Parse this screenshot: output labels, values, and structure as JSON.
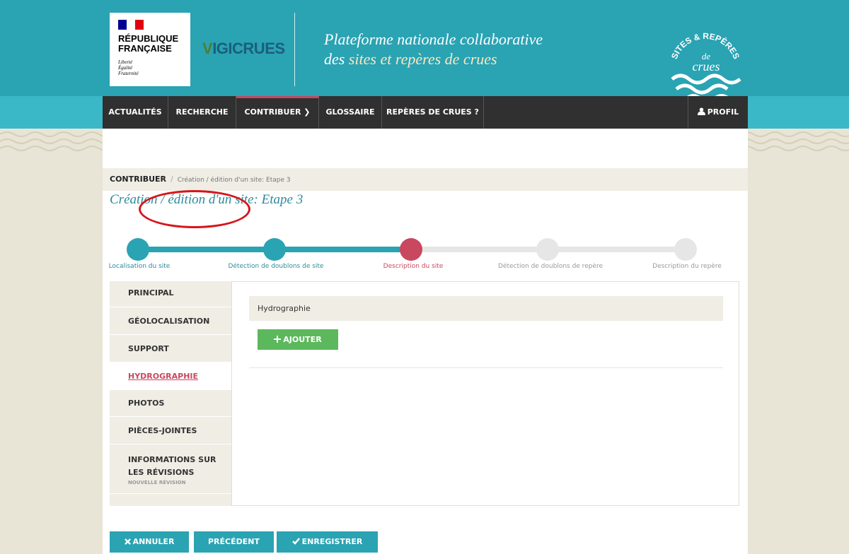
{
  "header": {
    "rf_title_line1": "RÉPUBLIQUE",
    "rf_title_line2": "FRANÇAISE",
    "rf_motto_1": "Liberté",
    "rf_motto_2": "Égalité",
    "rf_motto_3": "Fraternité",
    "vigicrues_v": "V",
    "vigicrues_rest": "IGICRUES",
    "tagline_line1": "Plateforme nationale collaborative",
    "tagline_line2_prefix": "des ",
    "tagline_line2_highlight": "sites et repères de crues",
    "sr_logo_top": "SITES & REPÈRES",
    "sr_logo_de": "de",
    "sr_logo_crues": "crues"
  },
  "nav": {
    "items": [
      {
        "label": "ACTUALITÉS"
      },
      {
        "label": "RECHERCHE"
      },
      {
        "label": "CONTRIBUER ❯"
      },
      {
        "label": "GLOSSAIRE"
      },
      {
        "label": "REPÈRES DE CRUES ?"
      }
    ],
    "profile": "PROFIL",
    "profile_icon": "user-icon",
    "active_index": 2
  },
  "breadcrumb": {
    "root": "CONTRIBUER",
    "separator": "/",
    "current": "Création / édition d'un site: Etape 3"
  },
  "page_title": "Création / édition d'un site: Etape 3",
  "stepper": {
    "steps": [
      {
        "label": "Localisation du site",
        "state": "done"
      },
      {
        "label": "Détection de doublons de site",
        "state": "done"
      },
      {
        "label": "Description du site",
        "state": "current"
      },
      {
        "label": "Détection de doublons de repère",
        "state": "todo"
      },
      {
        "label": "Description du repère",
        "state": "todo"
      }
    ]
  },
  "sidebar": {
    "items": [
      {
        "label": "PRINCIPAL"
      },
      {
        "label": "GÉOLOCALISATION"
      },
      {
        "label": "SUPPORT"
      },
      {
        "label": "HYDROGRAPHIE"
      },
      {
        "label": "PHOTOS"
      },
      {
        "label": "PIÈCES-JOINTES"
      },
      {
        "label": "INFORMATIONS SUR LES RÉVISIONS",
        "sub": "NOUVELLE RÉVISION"
      }
    ],
    "active_index": 3
  },
  "content": {
    "section_title": "Hydrographie",
    "add_button": "AJOUTER",
    "add_icon": "plus-icon"
  },
  "footer_buttons": {
    "cancel": "ANNULER",
    "cancel_icon": "x-icon",
    "previous": "PRÉCÉDENT",
    "save": "ENREGISTRER",
    "save_icon": "check-icon"
  },
  "colors": {
    "teal": "#2aa3b3",
    "dark_nav": "#303030",
    "accent_red": "#c9475f",
    "green": "#5cb85c",
    "beige": "#f0ede5"
  }
}
